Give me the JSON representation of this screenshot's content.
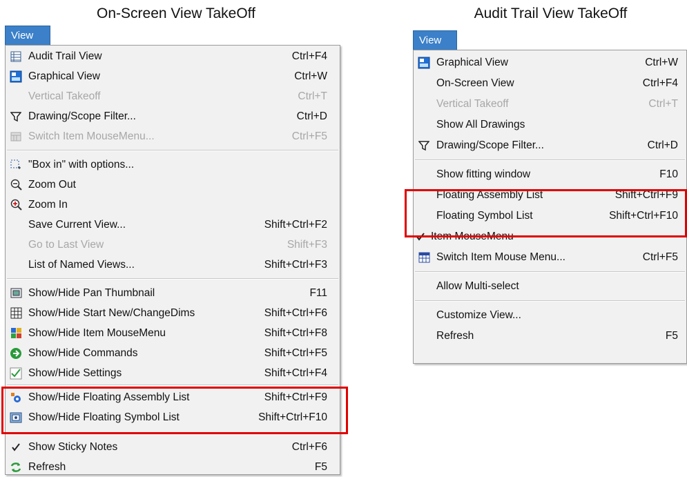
{
  "left": {
    "caption": "On-Screen View TakeOff",
    "menu_title": "View",
    "items": [
      {
        "label": "Audit Trail View",
        "shortcut": "Ctrl+F4",
        "icon": "grid-list-icon"
      },
      {
        "label": "Graphical View",
        "shortcut": "Ctrl+W",
        "icon": "graphical-view-icon"
      },
      {
        "label": "Vertical Takeoff",
        "shortcut": "Ctrl+T",
        "disabled": true
      },
      {
        "label": "Drawing/Scope Filter...",
        "shortcut": "Ctrl+D",
        "icon": "filter-icon"
      },
      {
        "label": "Switch Item MouseMenu...",
        "shortcut": "Ctrl+F5",
        "disabled": true,
        "icon": "switch-menu-icon"
      },
      {
        "label": "\"Box in\" with options...",
        "shortcut": "",
        "icon": "box-in-icon"
      },
      {
        "label": "Zoom Out",
        "shortcut": "",
        "icon": "zoom-out-icon"
      },
      {
        "label": "Zoom In",
        "shortcut": "",
        "icon": "zoom-in-icon"
      },
      {
        "label": "Save Current View...",
        "shortcut": "Shift+Ctrl+F2"
      },
      {
        "label": "Go to Last View",
        "shortcut": "Shift+F3",
        "disabled": true
      },
      {
        "label": "List of Named Views...",
        "shortcut": "Shift+Ctrl+F3"
      },
      {
        "label": "Show/Hide Pan Thumbnail",
        "shortcut": "F11",
        "icon": "thumbnail-icon"
      },
      {
        "label": "Show/Hide Start New/ChangeDims",
        "shortcut": "Shift+Ctrl+F6",
        "icon": "dims-icon"
      },
      {
        "label": "Show/Hide Item MouseMenu",
        "shortcut": "Shift+Ctrl+F8",
        "icon": "mousemenu-icon"
      },
      {
        "label": "Show/Hide Commands",
        "shortcut": "Shift+Ctrl+F5",
        "icon": "commands-icon"
      },
      {
        "label": "Show/Hide Settings",
        "shortcut": "Shift+Ctrl+F4",
        "icon": "settings-check-icon"
      },
      {
        "label": "Show/Hide Floating Assembly List",
        "shortcut": "Shift+Ctrl+F9",
        "icon": "assembly-list-icon"
      },
      {
        "label": "Show/Hide Floating Symbol List",
        "shortcut": "Shift+Ctrl+F10",
        "icon": "symbol-list-icon"
      },
      {
        "label": "Show Sticky Notes",
        "shortcut": "Ctrl+F6",
        "icon": "checkmark-icon"
      },
      {
        "label": "Refresh",
        "shortcut": "F5",
        "icon": "refresh-icon"
      }
    ]
  },
  "right": {
    "caption": "Audit Trail View TakeOff",
    "menu_title": "View",
    "items": [
      {
        "label": "Graphical View",
        "shortcut": "Ctrl+W",
        "icon": "graphical-view-icon"
      },
      {
        "label": "On-Screen View",
        "shortcut": "Ctrl+F4"
      },
      {
        "label": "Vertical Takeoff",
        "shortcut": "Ctrl+T",
        "disabled": true
      },
      {
        "label": "Show All Drawings",
        "shortcut": ""
      },
      {
        "label": "Drawing/Scope Filter...",
        "shortcut": "Ctrl+D",
        "icon": "filter-icon"
      },
      {
        "label": "Show fitting window",
        "shortcut": "F10"
      },
      {
        "label": "Floating Assembly List",
        "shortcut": "Shift+Ctrl+F9"
      },
      {
        "label": "Floating Symbol List",
        "shortcut": "Shift+Ctrl+F10"
      },
      {
        "label": "Item MouseMenu",
        "shortcut": "",
        "icon": "checkmark-icon"
      },
      {
        "label": "Switch Item Mouse Menu...",
        "shortcut": "Ctrl+F5",
        "icon": "switch-menu-icon"
      },
      {
        "label": "Allow Multi-select",
        "shortcut": ""
      },
      {
        "label": "Customize View...",
        "shortcut": ""
      },
      {
        "label": "Refresh",
        "shortcut": "F5"
      }
    ]
  },
  "colors": {
    "menu_tab": "#3b80c9",
    "highlight": "#e00000",
    "disabled_text": "#a7a7a7",
    "menu_bg": "#f1f1f1"
  }
}
